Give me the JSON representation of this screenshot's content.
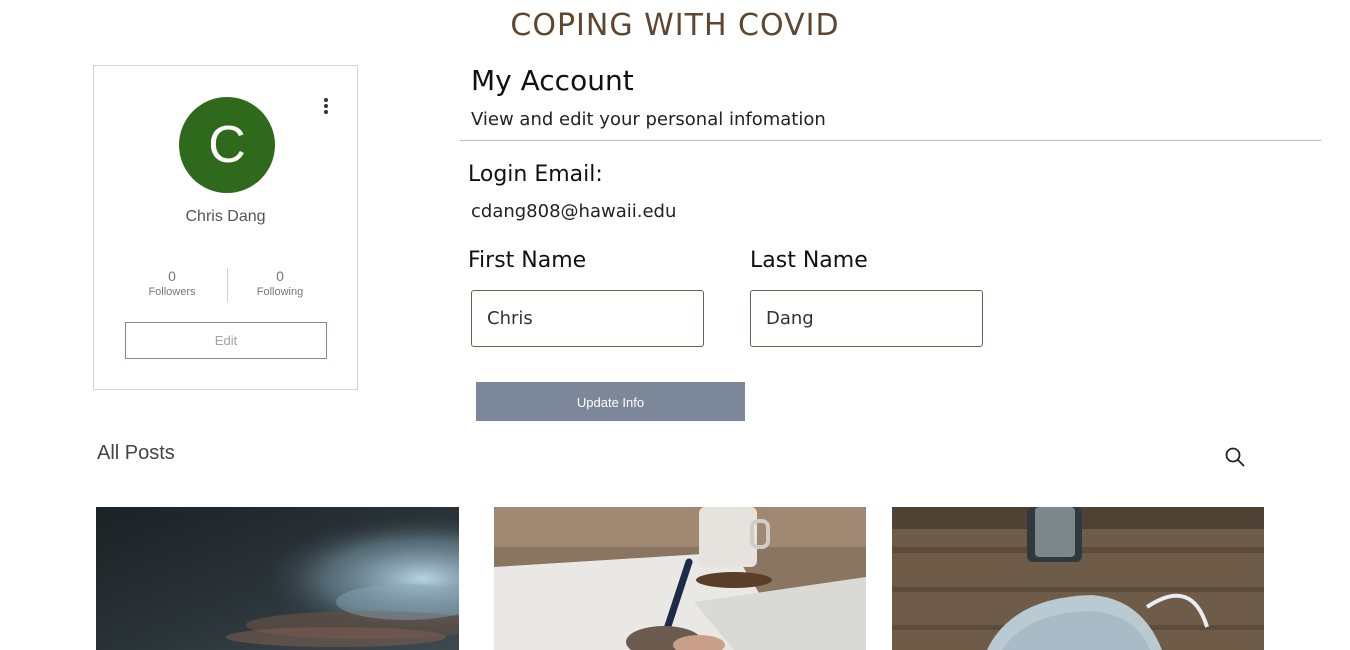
{
  "site": {
    "title": "COPING WITH COVID"
  },
  "profile": {
    "avatar_letter": "C",
    "avatar_color": "#2f6a1c",
    "name": "Chris Dang",
    "followers_count": "0",
    "followers_label": "Followers",
    "following_count": "0",
    "following_label": "Following",
    "edit_label": "Edit",
    "menu_icon": "more-vertical-icon"
  },
  "account": {
    "title": "My Account",
    "subtitle": "View and edit your personal infomation",
    "login_email_label": "Login Email:",
    "login_email_value": "cdang808@hawaii.edu",
    "first_name_label": "First Name",
    "first_name_value": "Chris",
    "last_name_label": "Last Name",
    "last_name_value": "Dang",
    "update_label": "Update Info",
    "update_color": "#7c8899"
  },
  "posts": {
    "heading": "All Posts",
    "search_icon": "search-icon",
    "items": [
      {
        "image": "stormy-sky-photo"
      },
      {
        "image": "writing-desk-photo"
      },
      {
        "image": "face-mask-photo"
      }
    ]
  }
}
